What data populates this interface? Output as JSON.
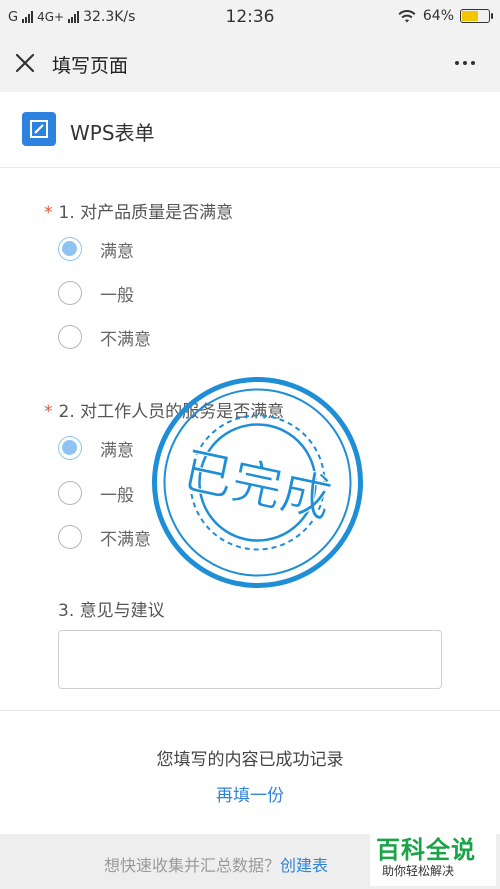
{
  "status_bar": {
    "carrier": "G",
    "network": "4G+",
    "speed": "32.3K/s",
    "time": "12:36",
    "battery_percent": "64%",
    "battery_level": 0.64
  },
  "title_bar": {
    "title": "填写页面"
  },
  "header": {
    "app_title": "WPS表单"
  },
  "questions": [
    {
      "label": "1. 对产品质量是否满意",
      "required_mark": "*",
      "options": [
        "满意",
        "一般",
        "不满意"
      ],
      "selected": "满意"
    },
    {
      "label": "2. 对工作人员的服务是否满意",
      "required_mark": "*",
      "options": [
        "满意",
        "一般",
        "不满意"
      ],
      "selected": "满意"
    },
    {
      "label": "3. 意见与建议"
    }
  ],
  "stamp_text": "已完成",
  "success_message": "您填写的内容已成功记录",
  "refill_link": "再填一份",
  "footer": {
    "text": "想快速收集并汇总数据？",
    "link": "创建表"
  },
  "watermark": {
    "main": "百科全说",
    "sub": "助你轻松解决"
  },
  "colors": {
    "accent_blue": "#2f84d8",
    "stamp_blue": "#1e8fd6",
    "radio_selected": "#8fc4f2",
    "required_star": "#e2543b",
    "watermark_green": "#1ca34a"
  }
}
